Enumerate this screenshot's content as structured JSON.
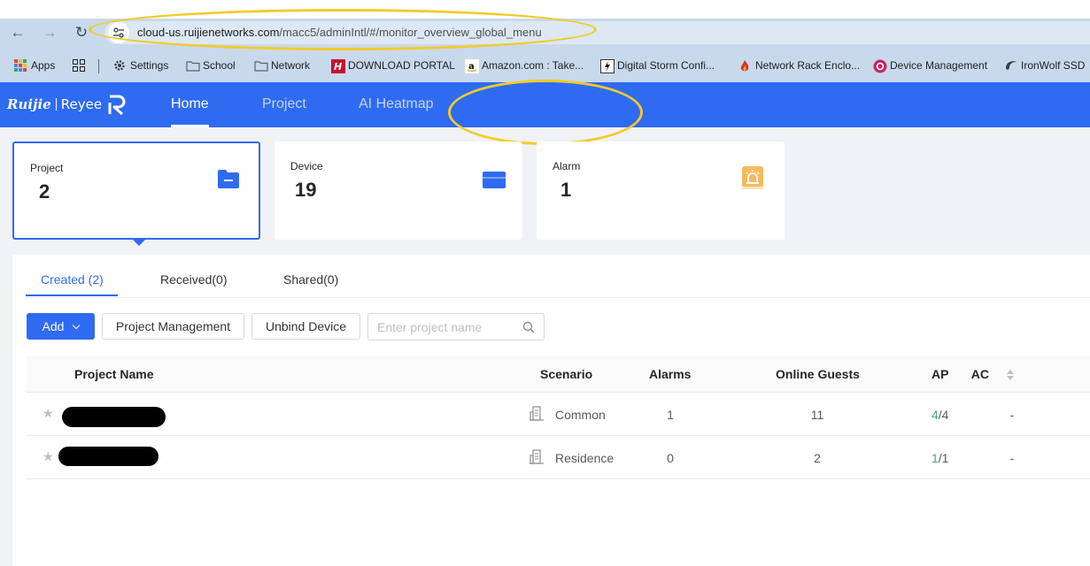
{
  "browser": {
    "url_host": "cloud-us.ruijienetworks.com",
    "url_path": "/macc5/adminIntl/#/monitor_overview_global_menu",
    "bookmarks": [
      {
        "label": "Apps"
      },
      {
        "label": "Settings"
      },
      {
        "label": "School"
      },
      {
        "label": "Network"
      },
      {
        "label": "DOWNLOAD PORTAL"
      },
      {
        "label": "Amazon.com : Take..."
      },
      {
        "label": "Digital Storm Confi..."
      },
      {
        "label": "Network Rack Enclo..."
      },
      {
        "label": "Device Management"
      },
      {
        "label": "IronWolf SSD"
      }
    ],
    "highlight_color": "#f2cb2a"
  },
  "header": {
    "logo_brand": "Ruijie",
    "logo_product": "Reyee",
    "nav": [
      {
        "label": "Home",
        "active": true
      },
      {
        "label": "Project",
        "active": false
      },
      {
        "label": "AI Heatmap",
        "active": false
      }
    ],
    "color": "#2f6bf1"
  },
  "summary": [
    {
      "label": "Project",
      "value": "2",
      "icon": "folder-icon",
      "selected": true
    },
    {
      "label": "Device",
      "value": "19",
      "icon": "device-icon",
      "selected": false
    },
    {
      "label": "Alarm",
      "value": "1",
      "icon": "alarm-icon",
      "selected": false
    }
  ],
  "tabs": [
    {
      "label": "Created (2)",
      "active": true
    },
    {
      "label": "Received(0)",
      "active": false
    },
    {
      "label": "Shared(0)",
      "active": false
    }
  ],
  "toolbar": {
    "add_label": "Add",
    "project_management_label": "Project Management",
    "unbind_device_label": "Unbind Device",
    "search_placeholder": "Enter project name"
  },
  "table": {
    "columns": [
      "Project Name",
      "Scenario",
      "Alarms",
      "Online Guests",
      "AP",
      "AC"
    ],
    "rows": [
      {
        "name_redacted": true,
        "scenario": "Common",
        "alarms": "1",
        "online_guests": "11",
        "ap_online": "4",
        "ap_total": "/4",
        "ac": "-"
      },
      {
        "name_redacted": true,
        "scenario": "Residence",
        "alarms": "0",
        "online_guests": "2",
        "ap_online": "1",
        "ap_total": "/1",
        "ac": "-"
      }
    ]
  }
}
